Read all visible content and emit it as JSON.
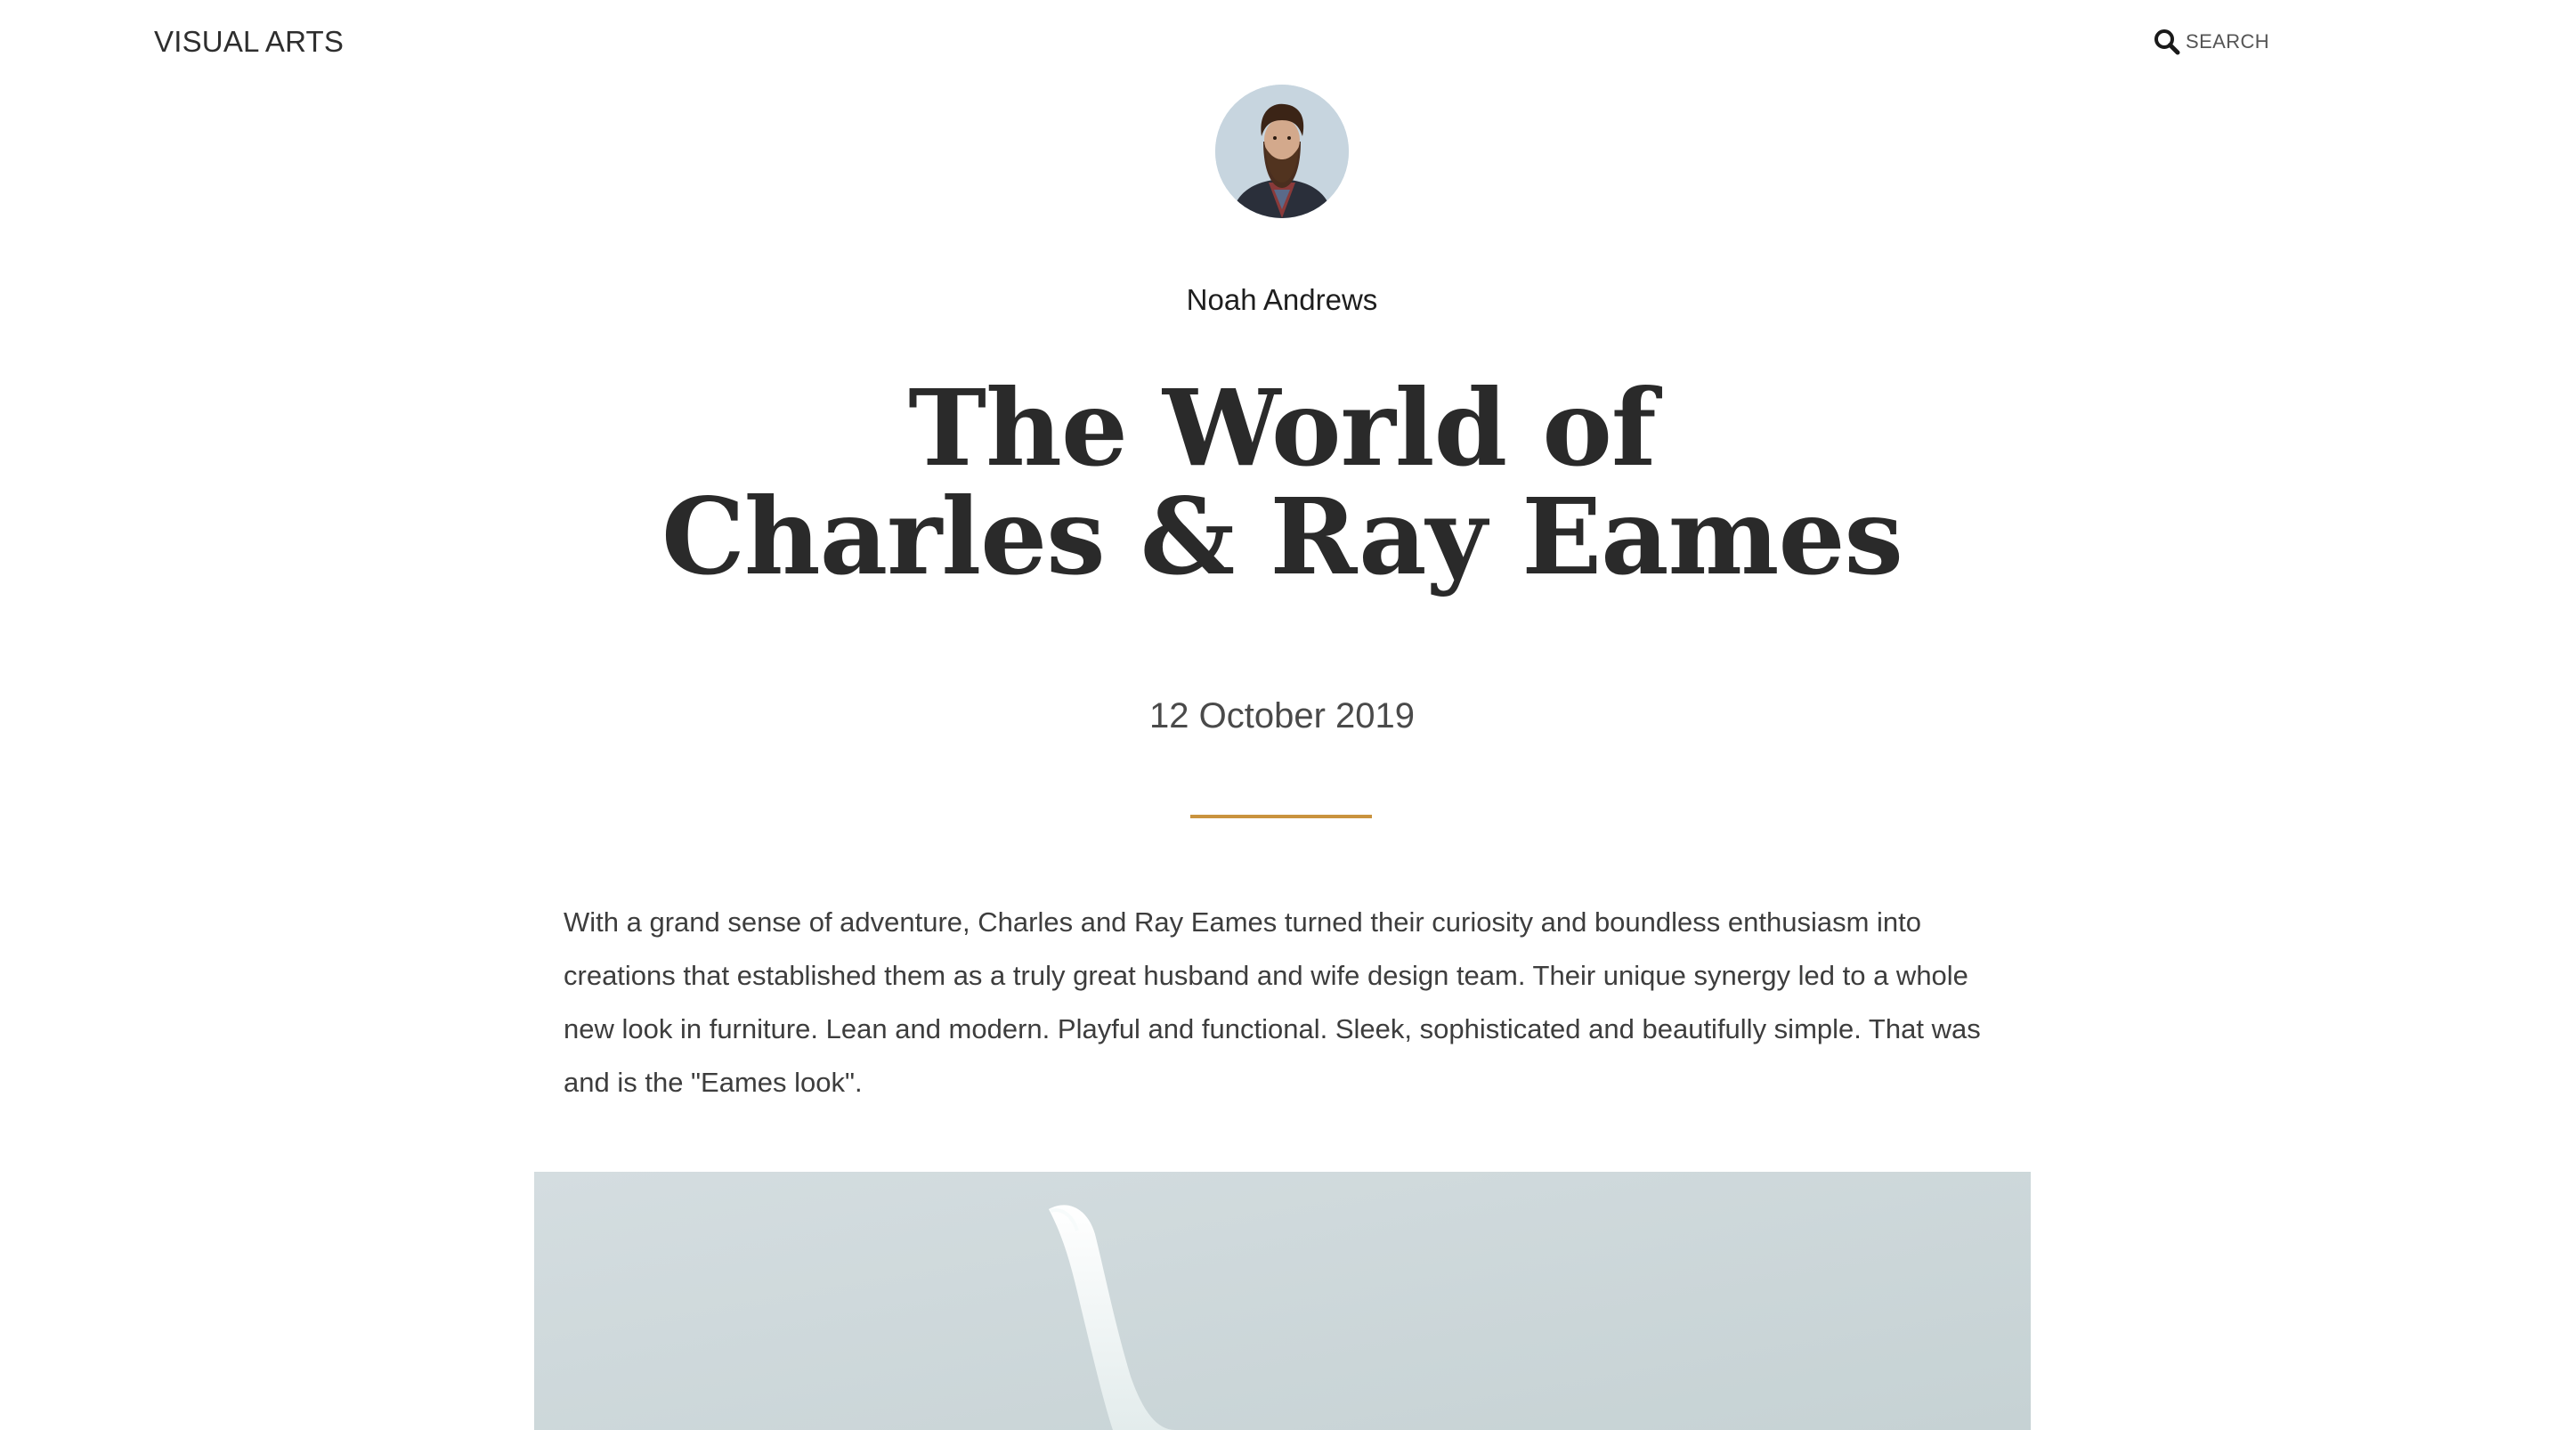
{
  "header": {
    "site_title": "VISUAL ARTS",
    "search_label": "SEARCH",
    "search_icon": "search-icon"
  },
  "author": {
    "name": "Noah Andrews",
    "avatar": "author-avatar-photo"
  },
  "article": {
    "title_line1": "The World of",
    "title_line2": "Charles & Ray Eames",
    "date": "12 October 2019",
    "intro": "With a grand sense of adventure, Charles and Ray Eames turned their curiosity and boundless enthusiasm into creations that established them as a truly great husband and wife design team. Their unique synergy led to a whole new look in furniture. Lean and modern. Playful and functional. Sleek, sophisticated and beautifully simple. That was and is the \"Eames look\".",
    "hero_image": "article-hero-photo"
  },
  "colors": {
    "accent": "#c9933e",
    "text": "#333333",
    "background": "#ffffff"
  }
}
